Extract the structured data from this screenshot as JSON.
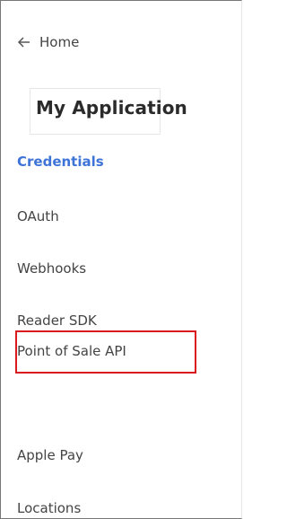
{
  "home_link": {
    "label": "Home"
  },
  "app": {
    "title": "My Application"
  },
  "nav": {
    "items": [
      {
        "label": "Credentials",
        "active": true
      },
      {
        "label": "OAuth",
        "active": false
      },
      {
        "label": "Webhooks",
        "active": false
      },
      {
        "label": "Reader SDK",
        "active": false
      },
      {
        "label": "Point of Sale API",
        "active": false,
        "highlighted": true
      },
      {
        "label": "Apple Pay",
        "active": false
      },
      {
        "label": "Locations",
        "active": false
      }
    ]
  },
  "colors": {
    "active_link": "#3e73d8",
    "highlight_border": "#d91a1f",
    "text": "#444444"
  }
}
